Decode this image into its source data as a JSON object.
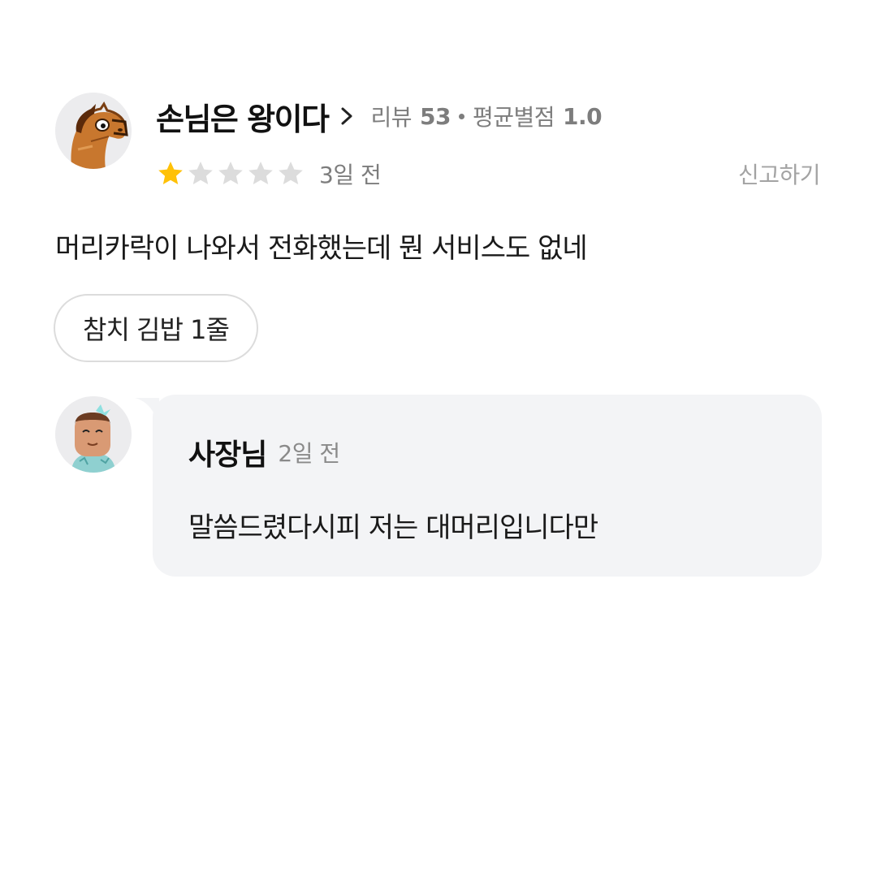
{
  "review": {
    "author": {
      "nickname": "손님은 왕이다",
      "avatar_icon": "horse-avatar-icon",
      "review_count_label": "리뷰",
      "review_count": "53",
      "avg_rating_label": "평균별점",
      "avg_rating": "1.0"
    },
    "rating": 1,
    "max_rating": 5,
    "time_ago": "3일 전",
    "report_label": "신고하기",
    "text": "머리카락이 나와서 전화했는데 뭔 서비스도 없네",
    "ordered_item": "참치 김밥 1줄"
  },
  "reply": {
    "author": "사장님",
    "avatar_icon": "owner-avatar-icon",
    "time_ago": "2일 전",
    "text": "말씀드렸다시피 저는 대머리입니다만"
  },
  "colors": {
    "star_filled": "#FFC107",
    "star_empty": "#DCDCDC",
    "meta_gray": "#7D7D7D",
    "reply_bg": "#F3F4F6"
  }
}
